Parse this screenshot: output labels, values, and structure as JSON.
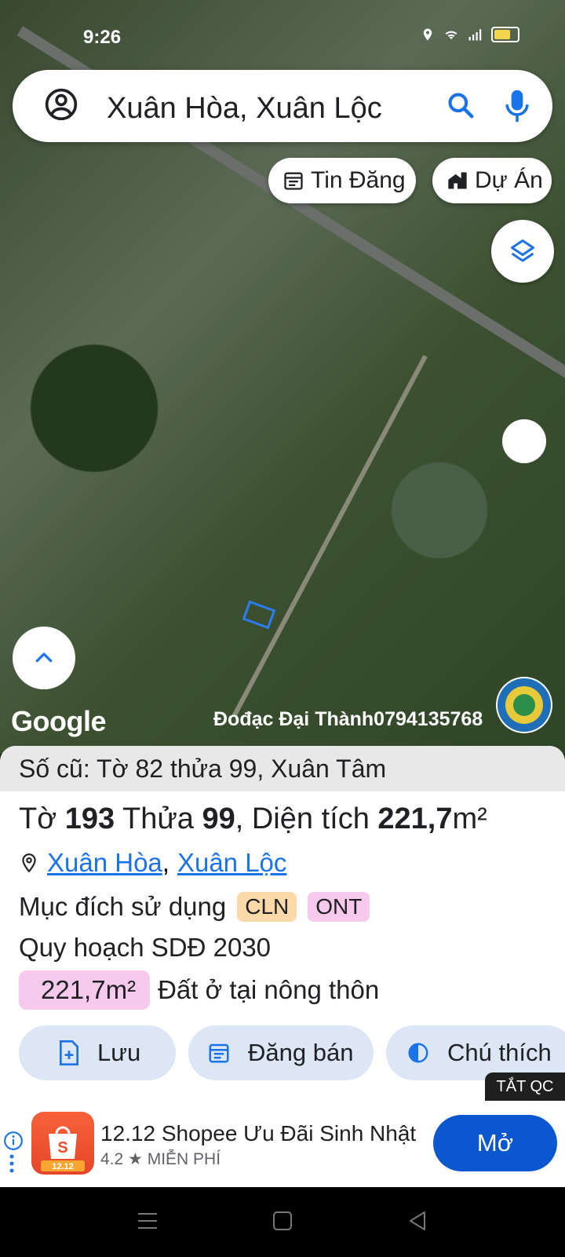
{
  "status": {
    "time": "9:26"
  },
  "search": {
    "text": "Xuân Hòa, Xuân Lộc"
  },
  "chips": {
    "news": "Tin Đăng",
    "project": "Dự Án"
  },
  "map": {
    "google_label": "Google",
    "watermark": "Đođạc Đại Thành0794135768"
  },
  "sheet": {
    "old_info": "Số cũ: Tờ 82 thửa 99, Xuân Tâm",
    "title": {
      "to_label": "Tờ",
      "to_value": "193",
      "thua_label": "Thửa",
      "thua_value": "99",
      "area_label": ", Diện tích",
      "area_value": "221,7",
      "area_unit": "m²"
    },
    "address": {
      "commune": "Xuân Hòa",
      "separator": ",",
      "district": "Xuân Lộc"
    },
    "purpose": {
      "label": "Mục đích sử dụng",
      "codes": [
        "CLN",
        "ONT"
      ]
    },
    "plan": "Quy hoạch SDĐ 2030",
    "area": {
      "value": "221,7m²",
      "desc": "Đất ở tại nông thôn"
    },
    "buttons": {
      "save": "Lưu",
      "sell": "Đăng bán",
      "legend": "Chú thích"
    }
  },
  "ad": {
    "off_label": "TẮT QC",
    "title": "12.12 Shopee Ưu Đãi Sinh Nhật",
    "rating": "4.2",
    "price": "MIỄN PHÍ",
    "icon_text": "12.12",
    "open": "Mở"
  },
  "colors": {
    "accent": "#1a73e8",
    "ad_button": "#0b57d0",
    "cln": "#fcd9a9",
    "ont": "#f7c9ec"
  }
}
